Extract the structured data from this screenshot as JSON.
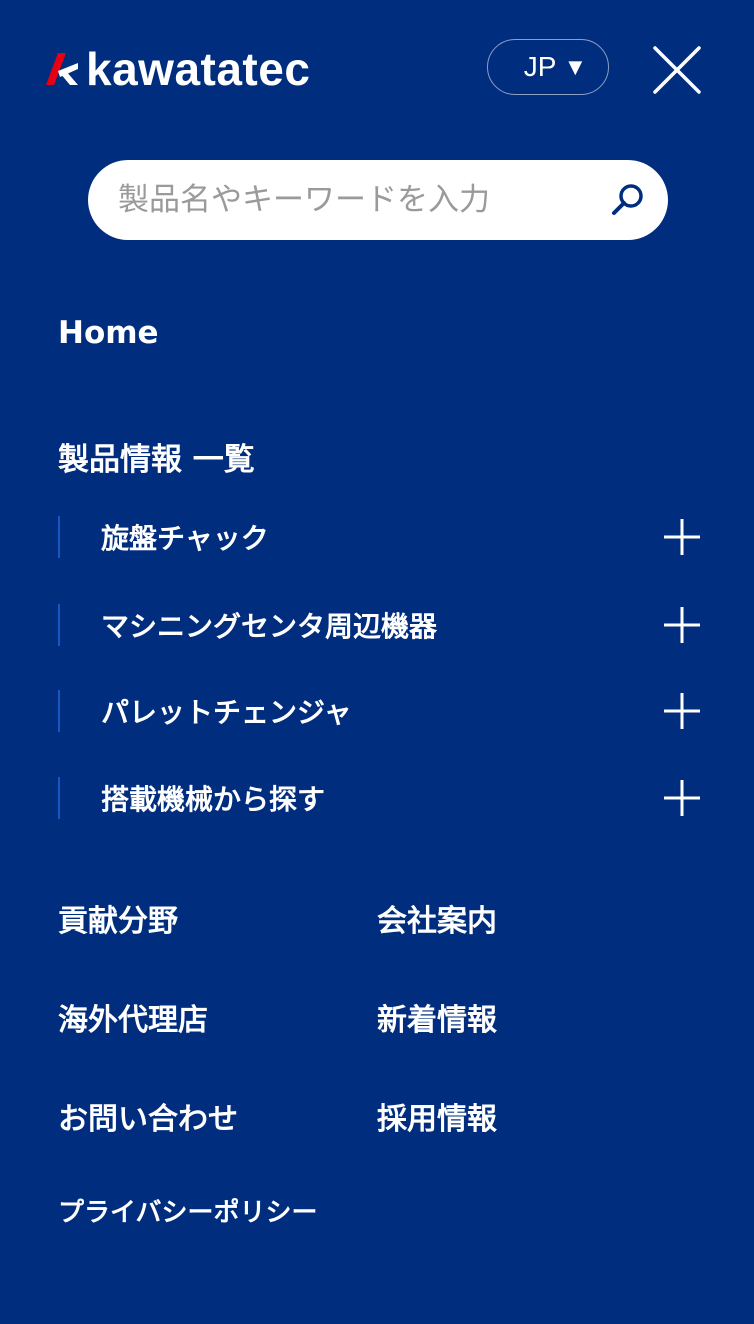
{
  "header": {
    "logo_text": "kawatatec",
    "logo_accent_color": "#e60012",
    "language": "JP",
    "close_icon": "close-icon"
  },
  "search": {
    "placeholder": "製品名やキーワードを入力",
    "value": "",
    "icon": "search-icon"
  },
  "nav": {
    "home": "Home",
    "products_title": "製品情報 一覧",
    "product_categories": [
      {
        "label": "旋盤チャック",
        "icon": "plus-icon"
      },
      {
        "label": "マシニングセンタ周辺機器",
        "icon": "plus-icon"
      },
      {
        "label": "パレットチェンジャ",
        "icon": "plus-icon"
      },
      {
        "label": "搭載機械から探す",
        "icon": "plus-icon"
      }
    ],
    "links": [
      "貢献分野",
      "会社案内",
      "海外代理店",
      "新着情報",
      "お問い合わせ",
      "採用情報",
      "プライバシーポリシー"
    ]
  },
  "colors": {
    "background": "#002d7d",
    "text": "#ffffff",
    "submenu_border": "#1a55c4",
    "search_bg": "#ffffff",
    "search_icon": "#002d7d"
  }
}
